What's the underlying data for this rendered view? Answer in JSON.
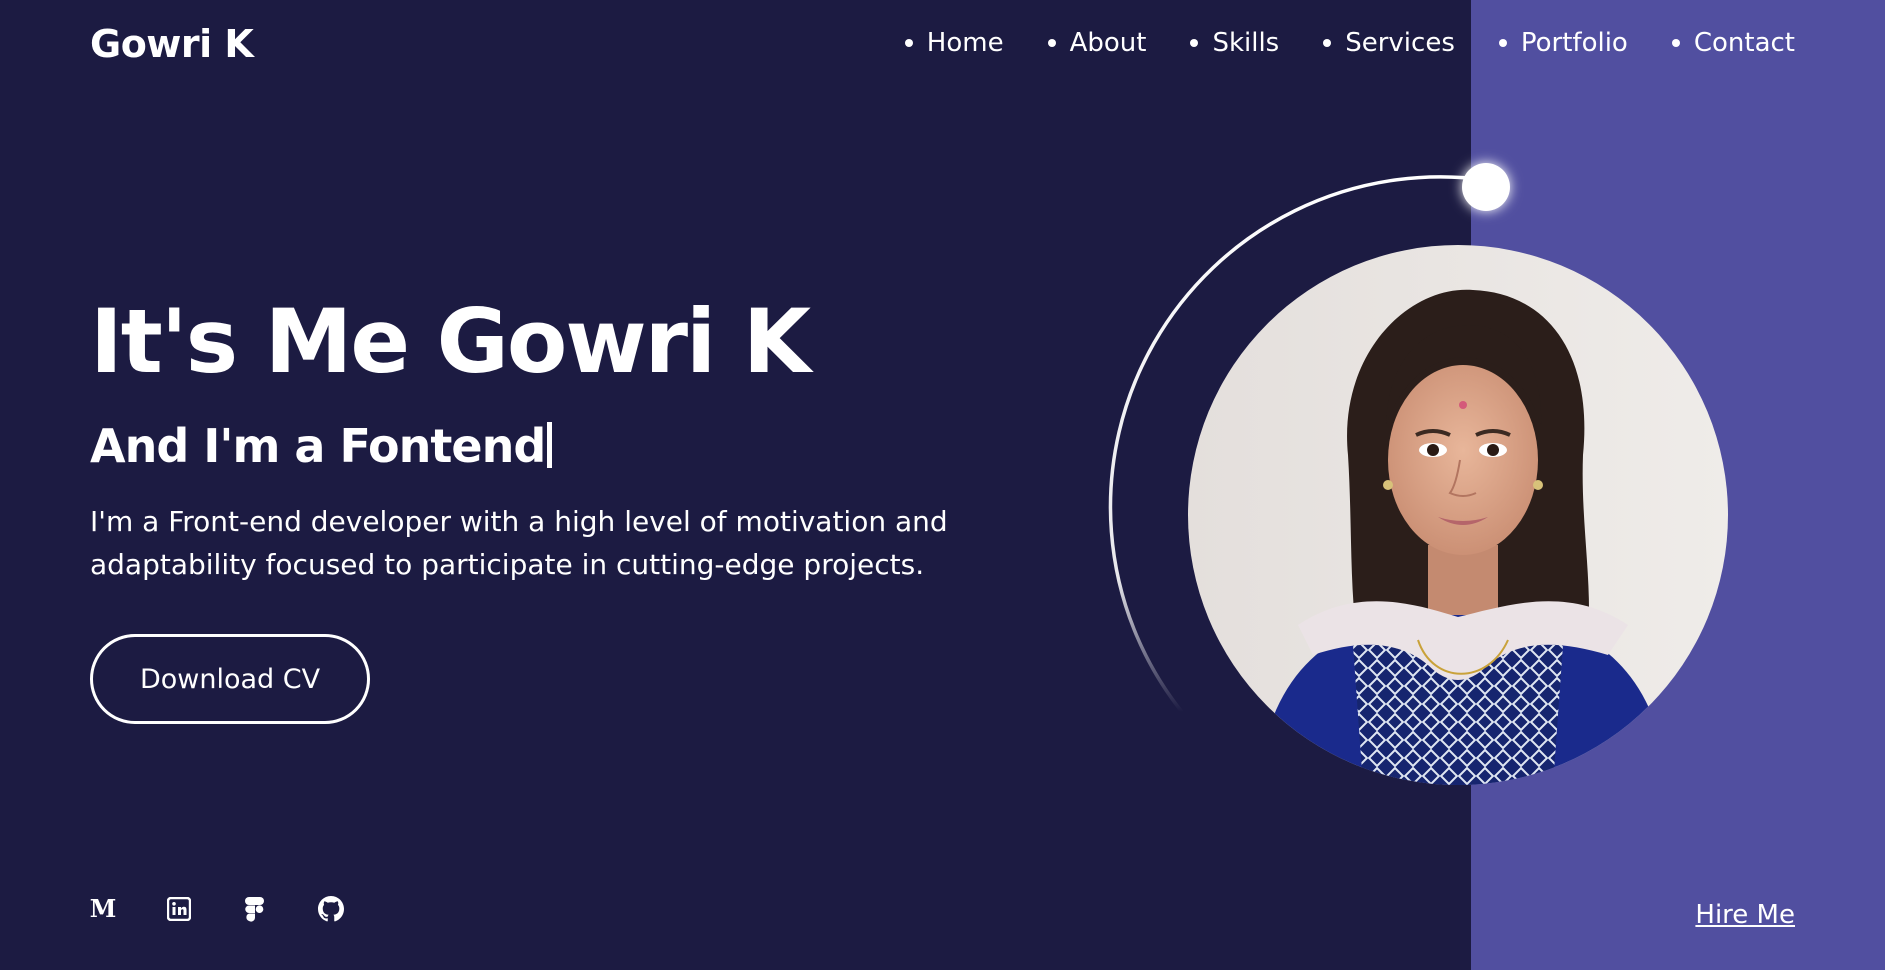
{
  "header": {
    "logo": "Gowri K",
    "nav": [
      "Home",
      "About",
      "Skills",
      "Services",
      "Portfolio",
      "Contact"
    ]
  },
  "hero": {
    "title": "It's Me Gowri K",
    "subtitle": "And I'm a Fontend",
    "description": "I'm a Front-end developer with a high level of motivation and adaptability focused to participate in cutting-edge projects.",
    "cv_button": "Download CV"
  },
  "socials": [
    {
      "icon": "medium-icon",
      "glyph": "M"
    },
    {
      "icon": "linkedin-icon"
    },
    {
      "icon": "figma-icon"
    },
    {
      "icon": "github-icon"
    }
  ],
  "footer": {
    "hire_label": "Hire Me"
  },
  "colors": {
    "background": "#1c1b42",
    "accent_panel": "#514fa0",
    "text": "#ffffff"
  }
}
